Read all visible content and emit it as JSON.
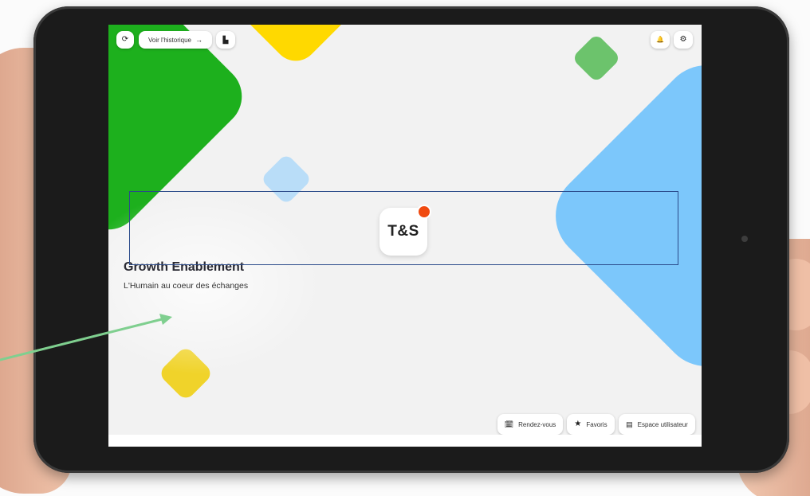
{
  "topbar": {
    "history_label": "Voir l'historique",
    "history_arrow": "→",
    "refresh_glyph": "⟳",
    "map_glyph": "▙",
    "bell_glyph": "🔔",
    "gear_glyph": "⚙"
  },
  "logo": {
    "text": "T&S",
    "dot_color": "#f04a10"
  },
  "hero": {
    "title": "Growth Enablement",
    "subtitle": "L'Humain au coeur des échanges"
  },
  "bottombar": {
    "appointments_label": "Rendez-vous",
    "appointments_glyph": "🗓",
    "favorites_label": "Favoris",
    "favorites_glyph": "★",
    "user_space_label": "Espace utilisateur",
    "user_space_glyph": "▤"
  },
  "colors": {
    "green": "#1db01d",
    "yellow": "#ffd900",
    "blue": "#7cc7fb",
    "annotation_box": "#2a4a8a",
    "annotation_arrow": "#7fcf8f"
  }
}
